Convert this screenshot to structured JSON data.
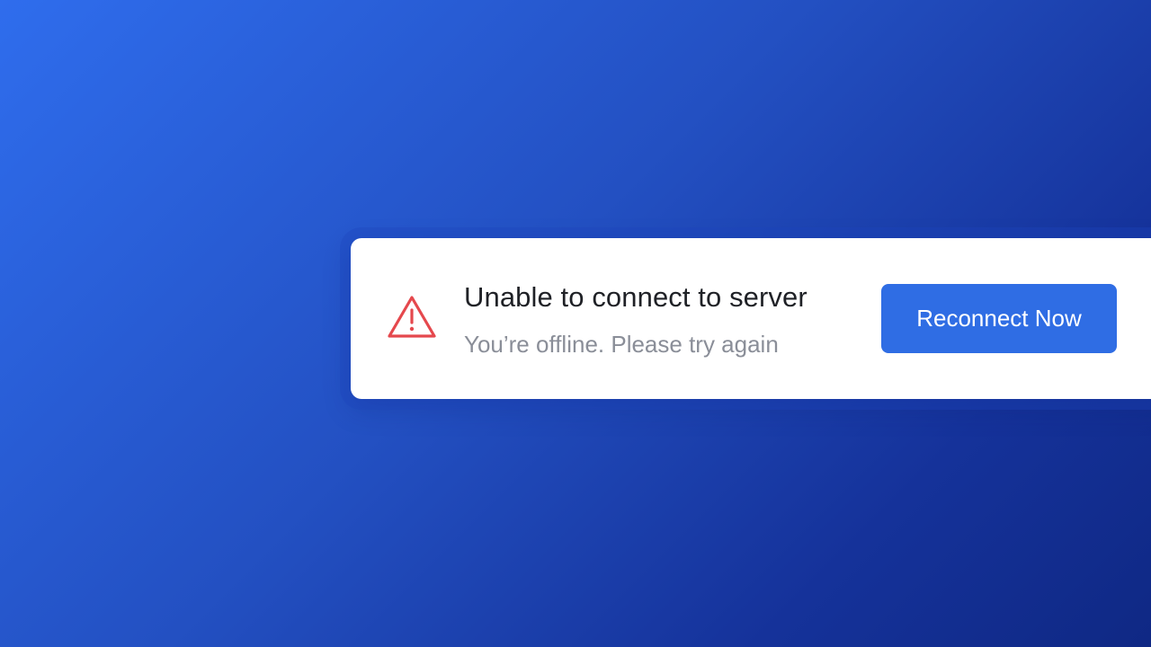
{
  "toast": {
    "icon": "warning-triangle-icon",
    "title": "Unable to connect to server",
    "message": "You’re offline. Please try again",
    "action_label": "Reconnect Now"
  },
  "colors": {
    "background_start": "#2f6ded",
    "background_end": "#0f2884",
    "card": "#ffffff",
    "warning": "#e5484d",
    "title": "#1f2126",
    "message": "#8a8e98",
    "button": "#2f6de4",
    "button_text": "#ffffff"
  }
}
